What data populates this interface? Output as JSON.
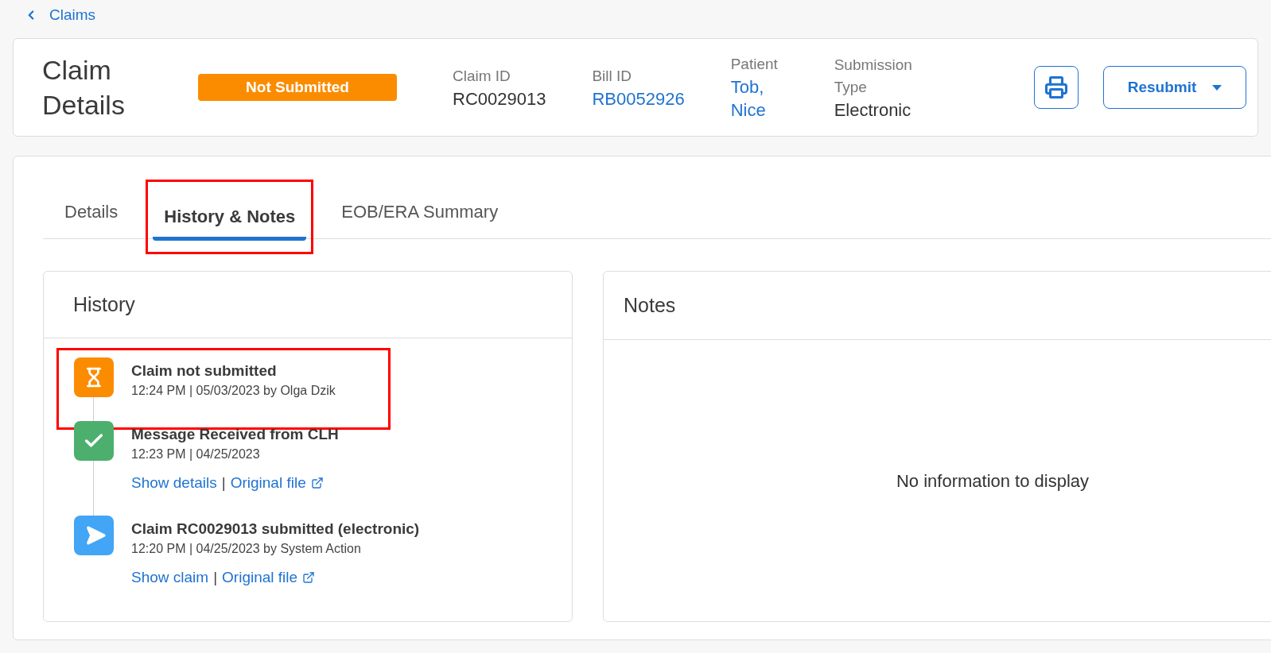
{
  "back_link": {
    "label": "Claims"
  },
  "header": {
    "title": "Claim Details",
    "status": "Not Submitted",
    "fields": [
      {
        "label": "Claim ID",
        "value": "RC0029013",
        "link": false
      },
      {
        "label": "Bill ID",
        "value": "RB0052926",
        "link": true
      },
      {
        "label": "Patient",
        "value": "Tob, Nice",
        "link": true
      },
      {
        "label": "Submission Type",
        "value": "Electronic",
        "link": false
      }
    ],
    "resubmit_button": "Resubmit"
  },
  "tabs": [
    {
      "label": "Details",
      "selected": false,
      "highlighted": false
    },
    {
      "label": "History & Notes",
      "selected": true,
      "highlighted": true
    },
    {
      "label": "EOB/ERA Summary",
      "selected": false,
      "highlighted": false
    }
  ],
  "history": {
    "title": "History",
    "items": [
      {
        "kind": "pending",
        "color": "#fb8c00",
        "title": "Claim not submitted",
        "meta": "12:24 PM | 05/03/2023 by Olga Dzik",
        "highlighted": true
      },
      {
        "kind": "received",
        "color": "#4caf6e",
        "title": "Message Received from CLH",
        "meta": "12:23 PM | 04/25/2023",
        "highlighted": false,
        "link_separator": "|",
        "links": [
          {
            "label": "Show details",
            "external": false
          },
          {
            "label": "Original file",
            "external": true
          }
        ]
      },
      {
        "kind": "sent",
        "color": "#42a5f5",
        "title": "Claim RC0029013 submitted (electronic)",
        "meta": "12:20 PM | 04/25/2023 by System Action",
        "highlighted": false,
        "link_separator": "|",
        "links": [
          {
            "label": "Show claim",
            "external": false
          },
          {
            "label": "Original file",
            "external": true
          }
        ]
      }
    ]
  },
  "notes": {
    "title": "Notes",
    "empty_message": "No information to display"
  }
}
